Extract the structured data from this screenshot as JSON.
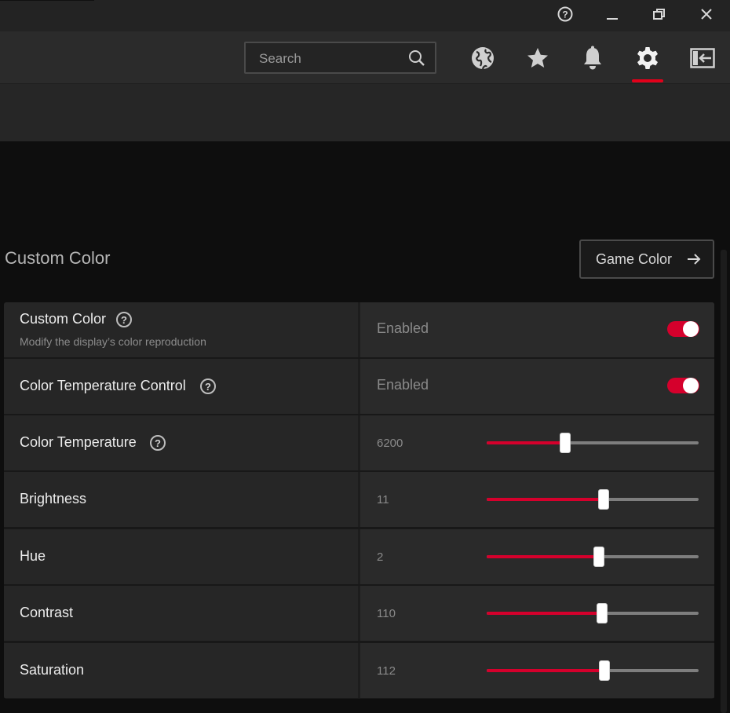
{
  "window": {
    "help_icon": "help-circle-icon",
    "minimize_icon": "minimize-icon",
    "restore_icon": "restore-icon",
    "close_icon": "close-icon"
  },
  "toolbar": {
    "search_placeholder": "Search",
    "icons": [
      "globe-icon",
      "star-icon",
      "bell-icon",
      "gear-icon",
      "sidebar-toggle-icon"
    ],
    "active_tab": "gear-icon",
    "accent_color": "#e2001a"
  },
  "section": {
    "title": "Custom Color",
    "game_color_label": "Game Color"
  },
  "settings": [
    {
      "label": "Custom Color",
      "description": "Modify the display’s color reproduction",
      "has_help": true,
      "control": "toggle",
      "status": "Enabled",
      "on": true
    },
    {
      "label": "Color Temperature Control",
      "has_help": true,
      "control": "toggle",
      "status": "Enabled",
      "on": true
    },
    {
      "label": "Color Temperature",
      "has_help": true,
      "control": "slider",
      "value": "6200",
      "fraction": 0.37
    },
    {
      "label": "Brightness",
      "has_help": false,
      "control": "slider",
      "value": "11",
      "fraction": 0.55
    },
    {
      "label": "Hue",
      "has_help": false,
      "control": "slider",
      "value": "2",
      "fraction": 0.53
    },
    {
      "label": "Contrast",
      "has_help": false,
      "control": "slider",
      "value": "110",
      "fraction": 0.545
    },
    {
      "label": "Saturation",
      "has_help": false,
      "control": "slider",
      "value": "112",
      "fraction": 0.555
    }
  ]
}
